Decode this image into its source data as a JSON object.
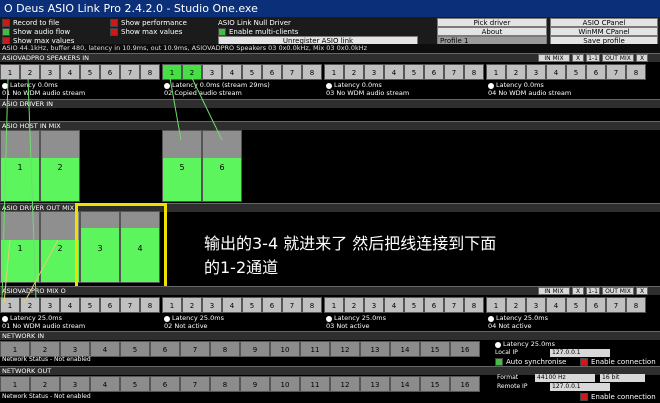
{
  "window": {
    "title": "O Deus ASIO Link Pro 2.4.2.0 - Studio One.exe"
  },
  "top": {
    "options_left": [
      {
        "label": "Record to file",
        "checked": false
      },
      {
        "label": "Show audio flow",
        "checked": true
      },
      {
        "label": "Show max values",
        "checked": false
      }
    ],
    "options_mid": [
      {
        "label": "Show performance",
        "checked": false
      },
      {
        "label": "Show max values",
        "checked": false
      }
    ],
    "null_driver": {
      "title": "ASIO Link Null Driver",
      "enable_label": "Enable multi-clients",
      "unregister_label": "Unregister ASIO link"
    },
    "buttons": {
      "pick_driver": "Pick driver",
      "about": "About",
      "profile": "Profile 1",
      "asio_cpanel": "ASIO CPanel",
      "winmm_cpanel": "WinMM CPanel",
      "save_profile": "Save profile"
    }
  },
  "status": "ASIO 44.1kHz, buffer 480, latency in 10.9ms, out 10.9ms, ASIOVADPRO Speakers 03 0x0.0kHz, Mix 03 0x0.0kHz",
  "sections": {
    "speakers_in": "ASIOVADPRO SPEAKERS IN",
    "driver_in": "ASIO DRIVER IN",
    "host_in_mix": "ASIO HOST IN MIX",
    "driver_out_mix": "ASIO DRIVER OUT MIX",
    "mix_out": "ASIOVADPRO MIX O",
    "network_in": "NETWORK IN",
    "network_out": "NETWORK OUT"
  },
  "header_buttons": {
    "in_mix": "IN MIX",
    "out_mix": "OUT MIX",
    "x": "X",
    "one_one": "1-1",
    "r": "R"
  },
  "channels": [
    "1",
    "2",
    "3",
    "4",
    "5",
    "6",
    "7",
    "8"
  ],
  "network_channels": [
    "1",
    "2",
    "3",
    "4",
    "5",
    "6",
    "7",
    "8",
    "9",
    "10",
    "11",
    "12",
    "13",
    "14",
    "15",
    "16"
  ],
  "speakers_groups": [
    {
      "latency": "Latency 0.0ms",
      "label": "01 No WDM audio stream"
    },
    {
      "latency": "Latency 0.0ms (stream 29ms)",
      "label": "02 Copied audio stream"
    },
    {
      "latency": "Latency 0.0ms",
      "label": "03 No WDM audio stream"
    },
    {
      "latency": "Latency 0.0ms",
      "label": "04 No WDM audio stream"
    }
  ],
  "mix_groups": [
    {
      "latency": "Latency 25.0ms",
      "label": "01 No WDM audio stream"
    },
    {
      "latency": "Latency 25.0ms",
      "label": "02 Not active"
    },
    {
      "latency": "Latency 25.0ms",
      "label": "03 Not active"
    },
    {
      "latency": "Latency 25.0ms",
      "label": "04 Not active"
    }
  ],
  "host_meters": [
    {
      "num": "1",
      "level": 0.62
    },
    {
      "num": "2",
      "level": 0.62
    },
    {
      "num": "5",
      "level": 0.62
    },
    {
      "num": "6",
      "level": 0.62
    }
  ],
  "out_meters": [
    {
      "num": "1",
      "level": 0.6
    },
    {
      "num": "2",
      "level": 0.6
    },
    {
      "num": "3",
      "level": 0.77
    },
    {
      "num": "4",
      "level": 0.77
    }
  ],
  "network_in": {
    "status": "Network Status - Not enabled",
    "latency": "Latency 25.0ms",
    "local_ip_label": "Local IP",
    "local_ip": "127.0.0.1",
    "auto_sync": "Auto synchronise",
    "enable_conn": "Enable connection"
  },
  "network_out": {
    "status": "Network Status - Not enabled",
    "format_label": "Format",
    "format_value": "44100 Hz",
    "bits": "16 bit",
    "remote_ip_label": "Remote IP",
    "remote_ip": "127.0.0.1",
    "enable_conn": "Enable connection"
  },
  "annotation": "输出的3-4 就进来了 然后把线连接到下面的1-2通道",
  "colors": {
    "meter_green": "#5df55d",
    "channel_green": "#44e044",
    "highlight": "#f0e000"
  }
}
